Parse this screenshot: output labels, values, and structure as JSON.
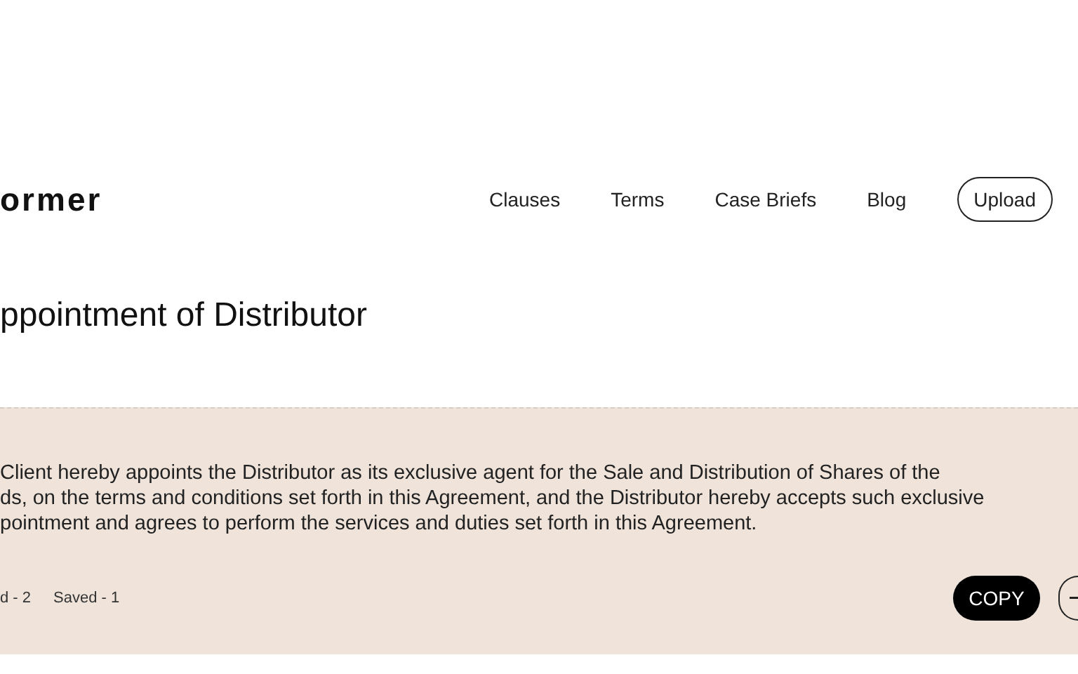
{
  "header": {
    "logo": "ormer",
    "nav": [
      {
        "label": "Clauses"
      },
      {
        "label": "Terms"
      },
      {
        "label": "Case Briefs"
      },
      {
        "label": "Blog"
      }
    ],
    "upload": "Upload"
  },
  "title": "ppointment of Distributor",
  "clause": {
    "lines": [
      "Client hereby appoints the Distributor as its exclusive agent for the Sale and Distribution of Shares of the",
      "ds, on the terms and conditions set forth in this Agreement, and the Distributor hereby accepts such exclusive",
      "pointment and agrees to perform the services and duties set forth in this Agreement."
    ],
    "stats": [
      "d - 2",
      "Saved - 1"
    ],
    "copy": "COPY"
  }
}
